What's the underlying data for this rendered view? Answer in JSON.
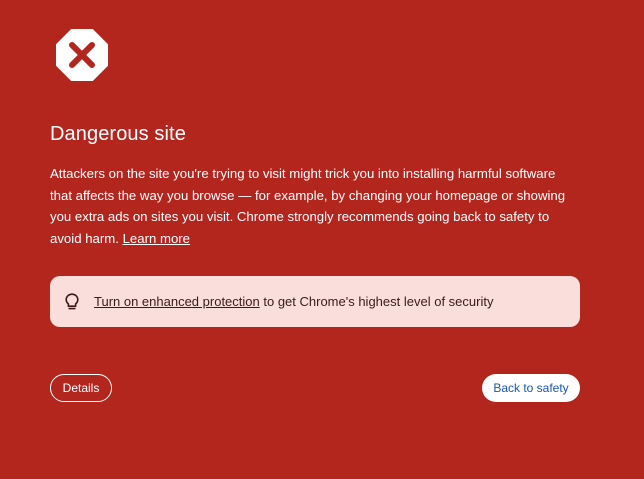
{
  "page": {
    "icon": "danger-octagon-x-icon",
    "title": "Dangerous site",
    "body_text": "Attackers on the site you're trying to visit might trick you into installing harmful software that affects the way you browse — for example, by changing your homepage or showing you extra ads on sites you visit. Chrome strongly recommends going back to safety to avoid harm. ",
    "learn_more": "Learn more"
  },
  "promo": {
    "icon": "lightbulb-icon",
    "link_text": "Turn on enhanced protection",
    "rest_text": " to get Chrome's highest level of security"
  },
  "buttons": {
    "details": "Details",
    "back_to_safety": "Back to safety"
  },
  "colors": {
    "background": "#b3261e",
    "promo_background": "#f9dedc",
    "back_button_text": "#1a56b8"
  }
}
